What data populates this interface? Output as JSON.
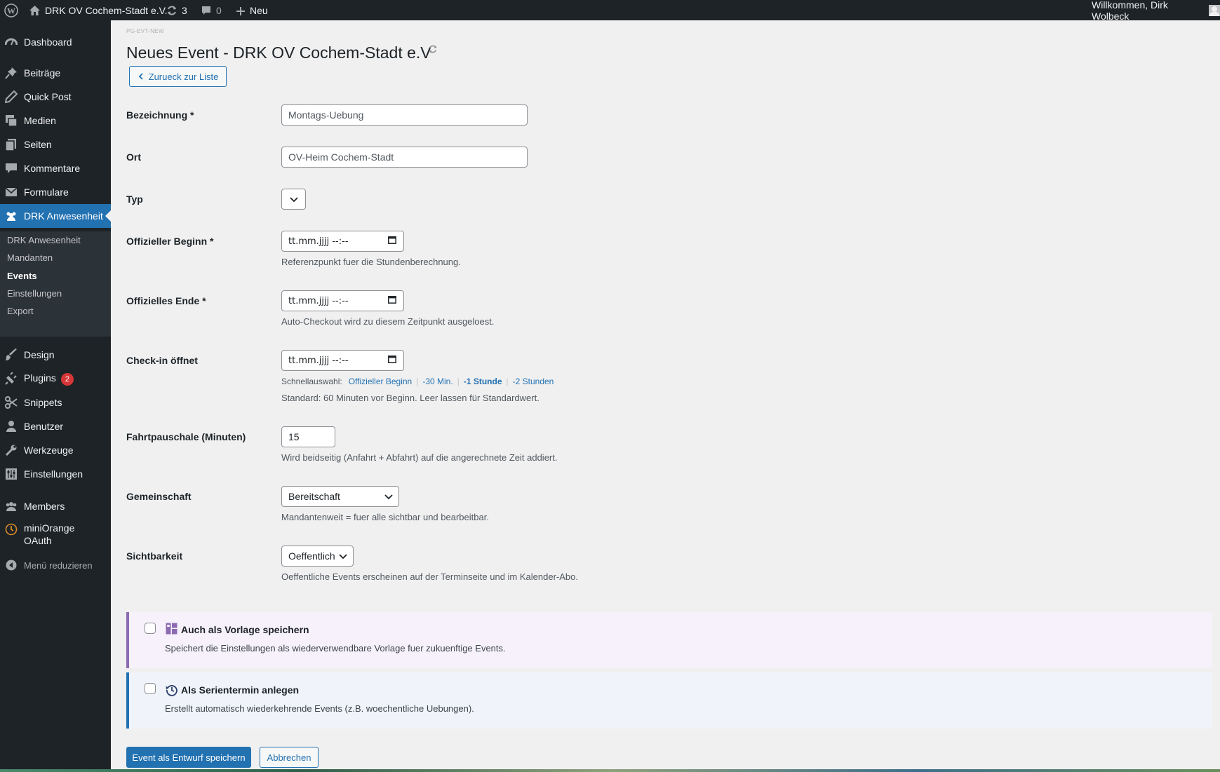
{
  "adminbar": {
    "site_name": "DRK OV Cochem-Stadt e.V.",
    "updates_count": "3",
    "comments_count": "0",
    "new_label": "Neu",
    "welcome": "Willkommen, Dirk Wolbeck"
  },
  "sidebar": {
    "dashboard": "Dashboard",
    "posts": "Beiträge",
    "quick_post": "Quick Post",
    "media": "Medien",
    "pages": "Seiten",
    "comments": "Kommentare",
    "forms": "Formulare",
    "drk": "DRK Anwesenheit",
    "sub": {
      "drk": "DRK Anwesenheit",
      "clients": "Mandanten",
      "events": "Events",
      "settings": "Einstellungen",
      "export": "Export"
    },
    "design": "Design",
    "plugins": "Plugins",
    "plugins_badge": "2",
    "snippets": "Snippets",
    "users": "Benutzer",
    "tools": "Werkzeuge",
    "settings": "Einstellungen",
    "members": "Members",
    "oauth_line1": "miniOrange",
    "oauth_line2": "OAuth",
    "collapse": "Menü reduzieren"
  },
  "page": {
    "page_id": "PG-EVT-NEW",
    "title": "Neues Event - DRK OV Cochem-Stadt e.V",
    "back_button": "Zurueck zur Liste"
  },
  "form": {
    "name_label": "Bezeichnung *",
    "name_value": "Montags-Uebung",
    "place_label": "Ort",
    "place_value": "OV-Heim Cochem-Stadt",
    "type_label": "Typ",
    "start_label": "Offizieller Beginn *",
    "start_value": "tt.mm.jjjj --:--",
    "start_desc": "Referenzpunkt fuer die Stundenberechnung.",
    "end_label": "Offizielles Ende *",
    "end_value": "tt.mm.jjjj --:--",
    "end_desc": "Auto-Checkout wird zu diesem Zeitpunkt ausgeloest.",
    "checkin_label": "Check-in öffnet",
    "checkin_value": "tt.mm.jjjj --:--",
    "quick_label": "Schnellauswahl:",
    "quick_options": [
      "Offizieller Beginn",
      "-30 Min.",
      "-1 Stunde",
      "-2 Stunden"
    ],
    "checkin_desc": "Standard: 60 Minuten vor Beginn. Leer lassen für Standardwert.",
    "travel_label": "Fahrtpauschale (Minuten)",
    "travel_value": "15",
    "travel_desc": "Wird beidseitig (Anfahrt + Abfahrt) auf die angerechnete Zeit addiert.",
    "community_label": "Gemeinschaft",
    "community_value": "Bereitschaft",
    "community_desc": "Mandantenweit = fuer alle sichtbar und bearbeitbar.",
    "visibility_label": "Sichtbarkeit",
    "visibility_value": "Oeffentlich",
    "visibility_desc": "Oeffentliche Events erscheinen auf der Terminseite und im Kalender-Abo."
  },
  "template_box": {
    "title": "Auch als Vorlage speichern",
    "desc": "Speichert die Einstellungen als wiederverwendbare Vorlage fuer zukuenftige Events.",
    "accent": "#8c6bb1",
    "bg": "#f6f1fa"
  },
  "series_box": {
    "title": "Als Serientermin anlegen",
    "desc": "Erstellt automatisch wiederkehrende Events (z.B. woechentliche Uebungen).",
    "accent": "#2271b1",
    "bg": "#f0f3f9"
  },
  "actions": {
    "save": "Event als Entwurf speichern",
    "cancel": "Abbrechen"
  }
}
